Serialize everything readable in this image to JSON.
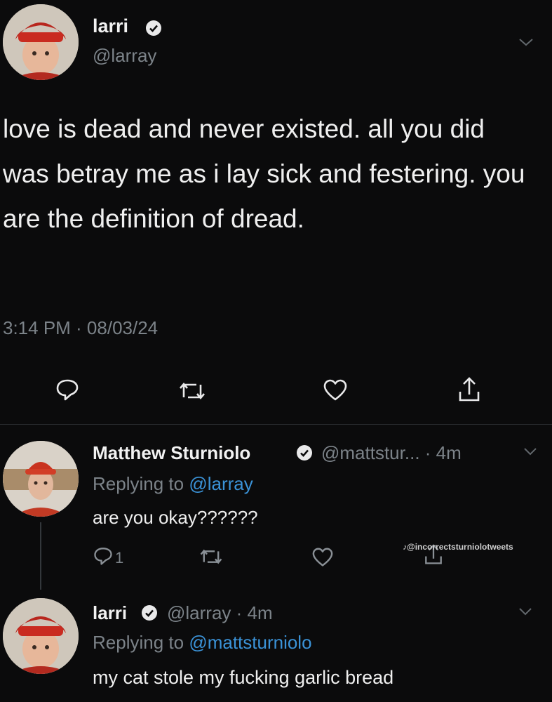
{
  "main_tweet": {
    "display_name": "larri",
    "handle": "@larray",
    "text": "love is dead and never existed. all you did was betray me as i lay sick and festering. you are the definition of dread.",
    "timestamp": "3:14 PM · 08/03/24"
  },
  "reply1": {
    "display_name": "Matthew Sturniolo",
    "handle_time": "@mattstur... · 4m",
    "replying_prefix": "Replying to ",
    "replying_to": "@larray",
    "text": "are you okay??????",
    "reply_count": "1"
  },
  "reply2": {
    "display_name": "larri",
    "handle_time": "@larray · 4m",
    "replying_prefix": "Replying to ",
    "replying_to": "@mattsturniolo",
    "text": "my cat stole my fucking garlic bread"
  },
  "watermark": "@incorrectsturniolotweets",
  "icons": [
    "verified-badge",
    "chevron-down",
    "reply",
    "retweet",
    "like",
    "share"
  ],
  "colors": {
    "background": "#0b0b0c",
    "link": "#3b93d8",
    "muted": "#7c8389",
    "text": "#e9e9ea"
  }
}
